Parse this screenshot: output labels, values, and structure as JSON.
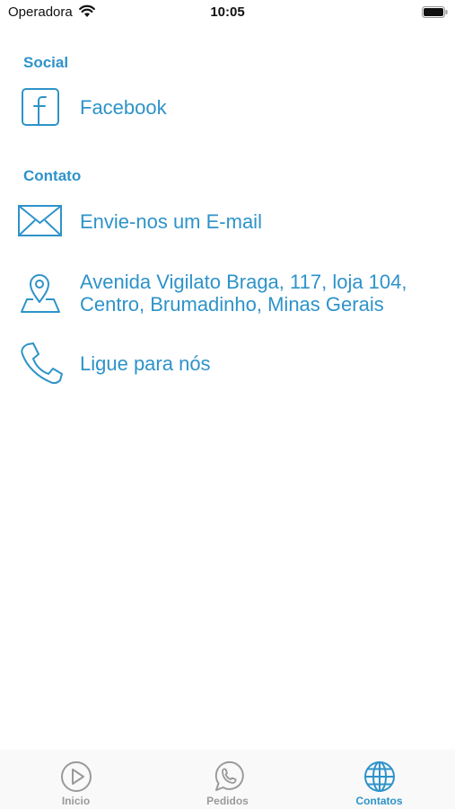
{
  "status_bar": {
    "carrier": "Operadora",
    "time": "10:05"
  },
  "sections": {
    "social": {
      "title": "Social",
      "items": [
        {
          "label": "Facebook",
          "icon": "facebook-icon"
        }
      ]
    },
    "contato": {
      "title": "Contato",
      "items": [
        {
          "label": "Envie-nos um E-mail",
          "icon": "envelope-icon"
        },
        {
          "line1": "Avenida Vigilato Braga, 117, loja 104,",
          "line2": "Centro, Brumadinho, Minas Gerais",
          "icon": "map-pin-icon"
        },
        {
          "label": "Ligue para nós",
          "icon": "phone-icon"
        }
      ]
    }
  },
  "tab_bar": {
    "tabs": [
      {
        "label": "Inicio",
        "icon": "play-circle-icon",
        "selected": false
      },
      {
        "label": "Pedidos",
        "icon": "whatsapp-icon",
        "selected": false
      },
      {
        "label": "Contatos",
        "icon": "globe-icon",
        "selected": true
      }
    ]
  },
  "colors": {
    "accent": "#2e93c9",
    "inactive": "#9a9a9a",
    "background": "#ffffff",
    "tab_bar_bg": "#f9f9f9"
  }
}
